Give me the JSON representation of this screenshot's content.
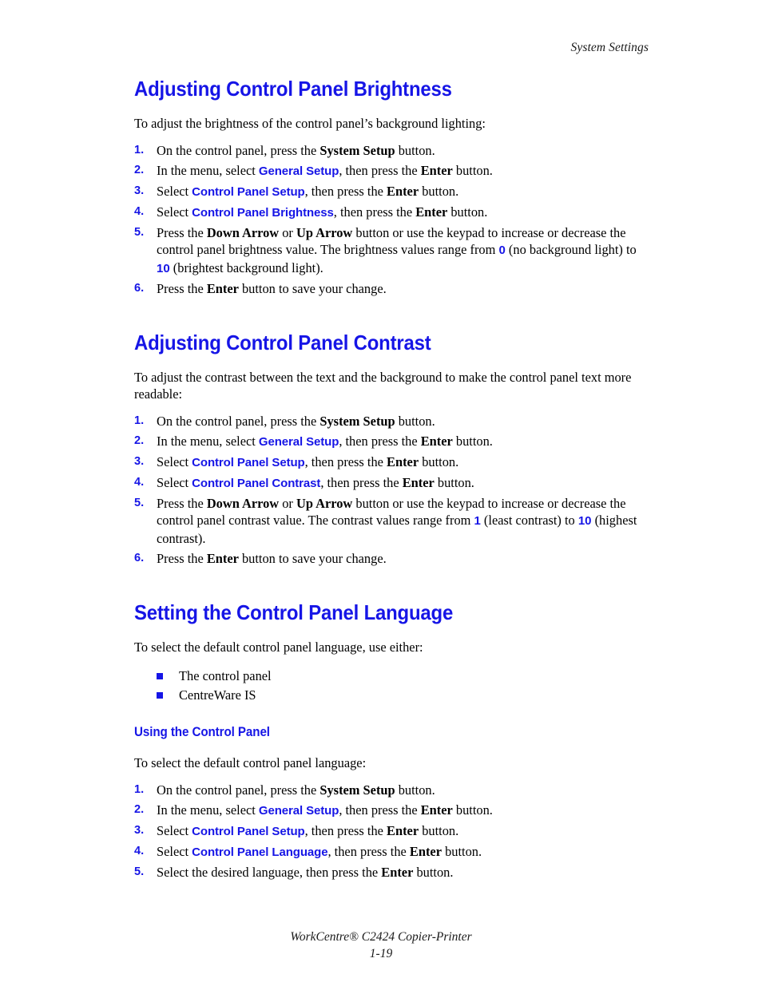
{
  "header": {
    "running_head": "System Settings"
  },
  "footer": {
    "product": "WorkCentre® C2424 Copier-Printer",
    "page_number": "1-19"
  },
  "colors": {
    "heading_blue": "#1615e6",
    "ui_term_blue": "#1615e6",
    "body_black": "#000000"
  },
  "sections": [
    {
      "id": "brightness",
      "title": "Adjusting Control Panel Brightness",
      "intro": "To adjust the brightness of the control panel’s background lighting:",
      "steps": [
        {
          "num": "1.",
          "text_parts": [
            {
              "t": "On the control panel, press the ",
              "s": "plain"
            },
            {
              "t": "System Setup",
              "s": "bold"
            },
            {
              "t": " button.",
              "s": "plain"
            }
          ]
        },
        {
          "num": "2.",
          "text_parts": [
            {
              "t": "In the menu, select ",
              "s": "plain"
            },
            {
              "t": "General Setup",
              "s": "ui"
            },
            {
              "t": ", then press the ",
              "s": "plain"
            },
            {
              "t": "Enter",
              "s": "bold"
            },
            {
              "t": " button.",
              "s": "plain"
            }
          ]
        },
        {
          "num": "3.",
          "text_parts": [
            {
              "t": "Select ",
              "s": "plain"
            },
            {
              "t": "Control Panel Setup",
              "s": "ui"
            },
            {
              "t": ", then press the ",
              "s": "plain"
            },
            {
              "t": "Enter",
              "s": "bold"
            },
            {
              "t": " button.",
              "s": "plain"
            }
          ]
        },
        {
          "num": "4.",
          "text_parts": [
            {
              "t": "Select ",
              "s": "plain"
            },
            {
              "t": "Control Panel Brightness",
              "s": "ui"
            },
            {
              "t": ", then press the ",
              "s": "plain"
            },
            {
              "t": "Enter",
              "s": "bold"
            },
            {
              "t": " button.",
              "s": "plain"
            }
          ]
        },
        {
          "num": "5.",
          "text_parts": [
            {
              "t": "Press the ",
              "s": "plain"
            },
            {
              "t": "Down Arrow",
              "s": "bold"
            },
            {
              "t": " or ",
              "s": "plain"
            },
            {
              "t": "Up Arrow",
              "s": "bold"
            },
            {
              "t": " button or use the keypad to increase or decrease the control panel brightness value. The brightness values range from ",
              "s": "plain"
            },
            {
              "t": "0",
              "s": "numhl"
            },
            {
              "t": " (no background light) to ",
              "s": "plain"
            },
            {
              "t": "10",
              "s": "numhl"
            },
            {
              "t": " (brightest background light).",
              "s": "plain"
            }
          ]
        },
        {
          "num": "6.",
          "text_parts": [
            {
              "t": "Press the ",
              "s": "plain"
            },
            {
              "t": "Enter",
              "s": "bold"
            },
            {
              "t": " button to save your change.",
              "s": "plain"
            }
          ]
        }
      ]
    },
    {
      "id": "contrast",
      "title": "Adjusting Control Panel Contrast",
      "intro": "To adjust the contrast between the text and the background to make the control panel text more readable:",
      "steps": [
        {
          "num": "1.",
          "text_parts": [
            {
              "t": "On the control panel, press the ",
              "s": "plain"
            },
            {
              "t": "System Setup",
              "s": "bold"
            },
            {
              "t": " button.",
              "s": "plain"
            }
          ]
        },
        {
          "num": "2.",
          "text_parts": [
            {
              "t": "In the menu, select ",
              "s": "plain"
            },
            {
              "t": "General Setup",
              "s": "ui"
            },
            {
              "t": ", then press the ",
              "s": "plain"
            },
            {
              "t": "Enter",
              "s": "bold"
            },
            {
              "t": " button.",
              "s": "plain"
            }
          ]
        },
        {
          "num": "3.",
          "text_parts": [
            {
              "t": "Select ",
              "s": "plain"
            },
            {
              "t": "Control Panel Setup",
              "s": "ui"
            },
            {
              "t": ", then press the ",
              "s": "plain"
            },
            {
              "t": "Enter",
              "s": "bold"
            },
            {
              "t": " button.",
              "s": "plain"
            }
          ]
        },
        {
          "num": "4.",
          "text_parts": [
            {
              "t": "Select ",
              "s": "plain"
            },
            {
              "t": "Control Panel Contrast",
              "s": "ui"
            },
            {
              "t": ", then press the ",
              "s": "plain"
            },
            {
              "t": "Enter",
              "s": "bold"
            },
            {
              "t": " button.",
              "s": "plain"
            }
          ]
        },
        {
          "num": "5.",
          "text_parts": [
            {
              "t": "Press the ",
              "s": "plain"
            },
            {
              "t": "Down Arrow",
              "s": "bold"
            },
            {
              "t": " or ",
              "s": "plain"
            },
            {
              "t": "Up Arrow",
              "s": "bold"
            },
            {
              "t": " button or use the keypad to increase or decrease the control panel contrast value. The contrast values range from ",
              "s": "plain"
            },
            {
              "t": "1",
              "s": "numhl"
            },
            {
              "t": " (least contrast) to ",
              "s": "plain"
            },
            {
              "t": "10",
              "s": "numhl"
            },
            {
              "t": " (highest contrast).",
              "s": "plain"
            }
          ]
        },
        {
          "num": "6.",
          "text_parts": [
            {
              "t": "Press the ",
              "s": "plain"
            },
            {
              "t": "Enter",
              "s": "bold"
            },
            {
              "t": " button to save your change.",
              "s": "plain"
            }
          ]
        }
      ]
    }
  ],
  "language_section": {
    "title": "Setting the Control Panel Language",
    "intro": "To select the default control panel language, use either:",
    "bullets": [
      "The control panel",
      "CentreWare IS"
    ],
    "subsection": {
      "title": "Using the Control Panel",
      "intro": "To select the default control panel language:",
      "steps": [
        {
          "num": "1.",
          "text_parts": [
            {
              "t": "On the control panel, press the ",
              "s": "plain"
            },
            {
              "t": "System Setup",
              "s": "bold"
            },
            {
              "t": " button.",
              "s": "plain"
            }
          ]
        },
        {
          "num": "2.",
          "text_parts": [
            {
              "t": "In the menu, select ",
              "s": "plain"
            },
            {
              "t": "General Setup",
              "s": "ui"
            },
            {
              "t": ", then press the ",
              "s": "plain"
            },
            {
              "t": "Enter",
              "s": "bold"
            },
            {
              "t": " button.",
              "s": "plain"
            }
          ]
        },
        {
          "num": "3.",
          "text_parts": [
            {
              "t": "Select ",
              "s": "plain"
            },
            {
              "t": "Control Panel Setup",
              "s": "ui"
            },
            {
              "t": ", then press the ",
              "s": "plain"
            },
            {
              "t": "Enter",
              "s": "bold"
            },
            {
              "t": " button.",
              "s": "plain"
            }
          ]
        },
        {
          "num": "4.",
          "text_parts": [
            {
              "t": "Select ",
              "s": "plain"
            },
            {
              "t": "Control Panel Language",
              "s": "ui"
            },
            {
              "t": ", then press the ",
              "s": "plain"
            },
            {
              "t": "Enter",
              "s": "bold"
            },
            {
              "t": " button.",
              "s": "plain"
            }
          ]
        },
        {
          "num": "5.",
          "text_parts": [
            {
              "t": "Select the desired language, then press the ",
              "s": "plain"
            },
            {
              "t": "Enter",
              "s": "bold"
            },
            {
              "t": " button.",
              "s": "plain"
            }
          ]
        }
      ]
    }
  }
}
